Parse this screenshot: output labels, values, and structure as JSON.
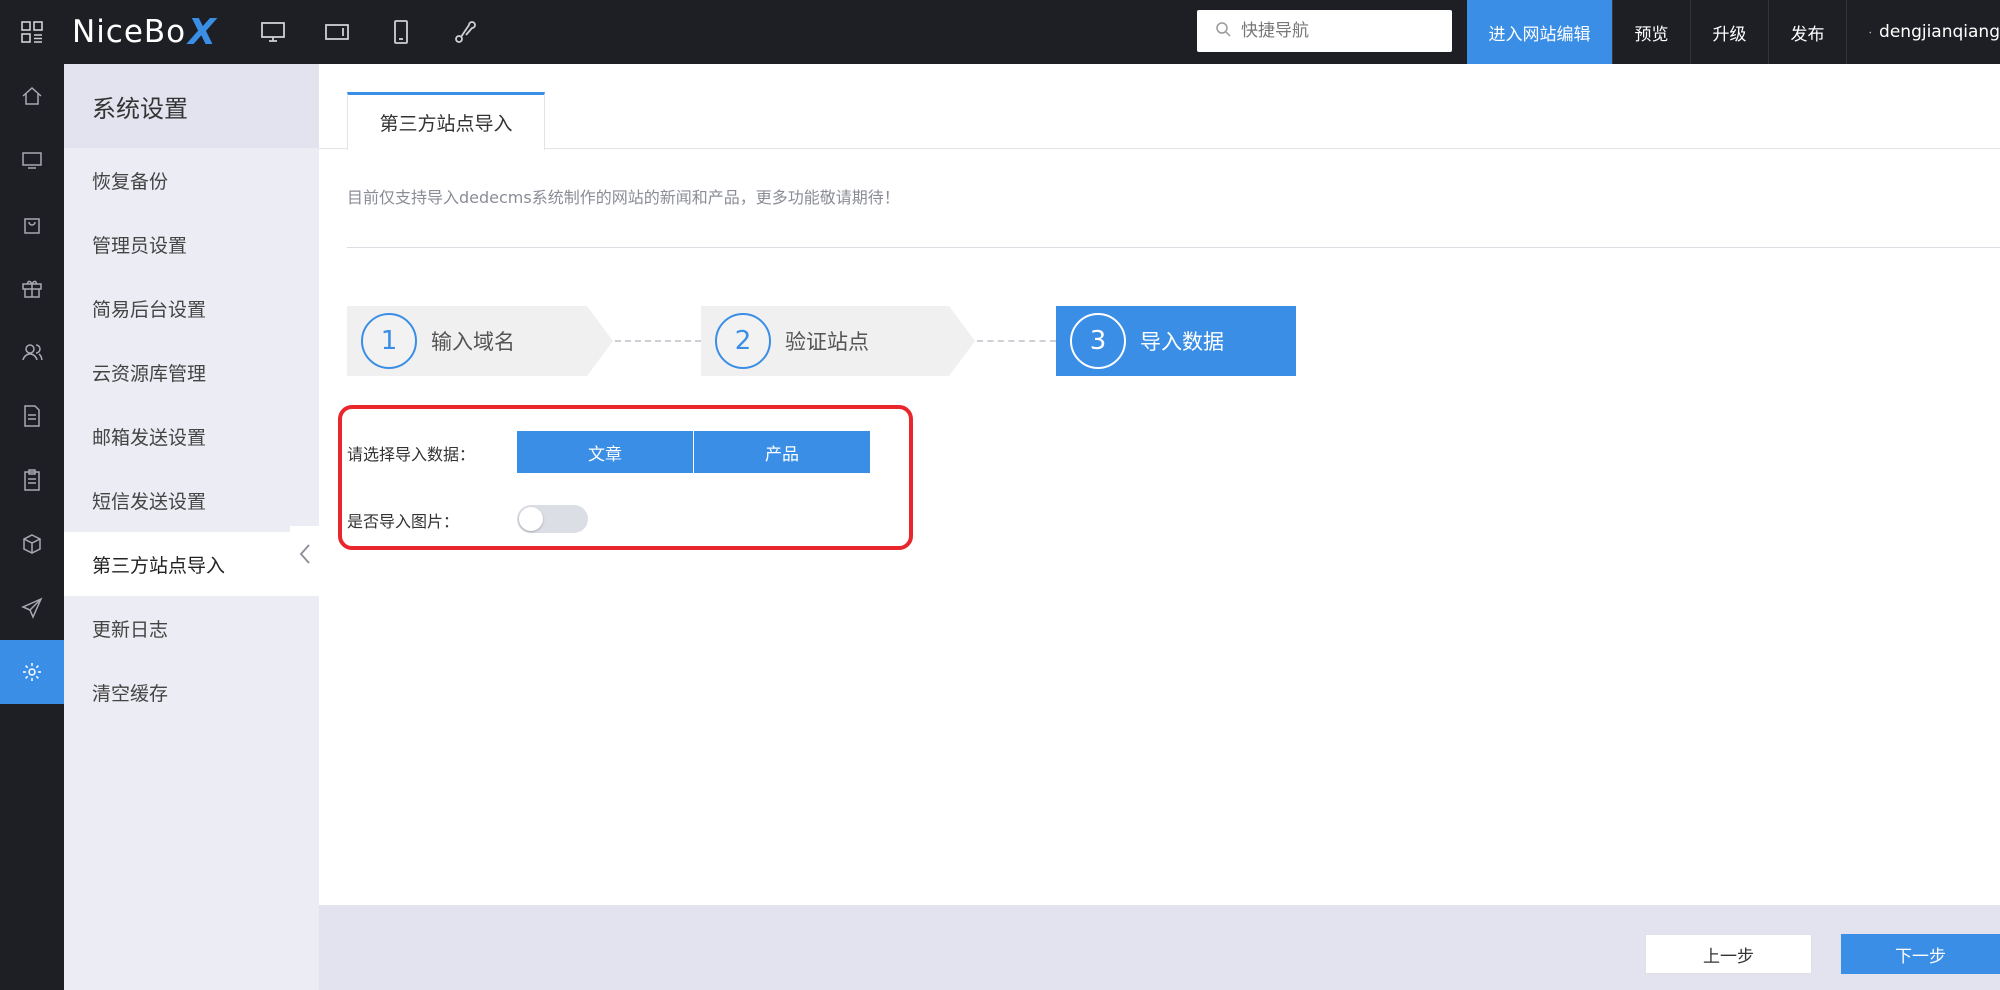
{
  "topbar": {
    "logo_text": "NiceBo",
    "logo_x": "X",
    "search_placeholder": "快捷导航",
    "actions": [
      "进入网站编辑",
      "预览",
      "升级",
      "发布"
    ],
    "user": "dengjianqiang",
    "accent_color": "#3a8ee6"
  },
  "rail": {
    "icons": [
      "home-icon",
      "monitor-icon",
      "bag-icon",
      "gift-icon",
      "users-icon",
      "document-icon",
      "clipboard-icon",
      "cube-icon",
      "send-icon",
      "settings-icon"
    ],
    "active": "settings-icon"
  },
  "submenu": {
    "title": "系统设置",
    "items": [
      "恢复备份",
      "管理员设置",
      "简易后台设置",
      "云资源库管理",
      "邮箱发送设置",
      "短信发送设置",
      "第三方站点导入",
      "更新日志",
      "清空缓存"
    ],
    "active": "第三方站点导入"
  },
  "main": {
    "tab": "第三方站点导入",
    "notice": "目前仅支持导入dedecms系统制作的网站的新闻和产品，更多功能敬请期待！",
    "steps": [
      {
        "num": "1",
        "label": "输入域名"
      },
      {
        "num": "2",
        "label": "验证站点"
      },
      {
        "num": "3",
        "label": "导入数据"
      }
    ],
    "active_step": 3,
    "select_label": "请选择导入数据：",
    "options": [
      "文章",
      "产品"
    ],
    "image_label": "是否导入图片：",
    "image_toggle_on": false
  },
  "footer": {
    "prev": "上一步",
    "next": "下一步"
  }
}
